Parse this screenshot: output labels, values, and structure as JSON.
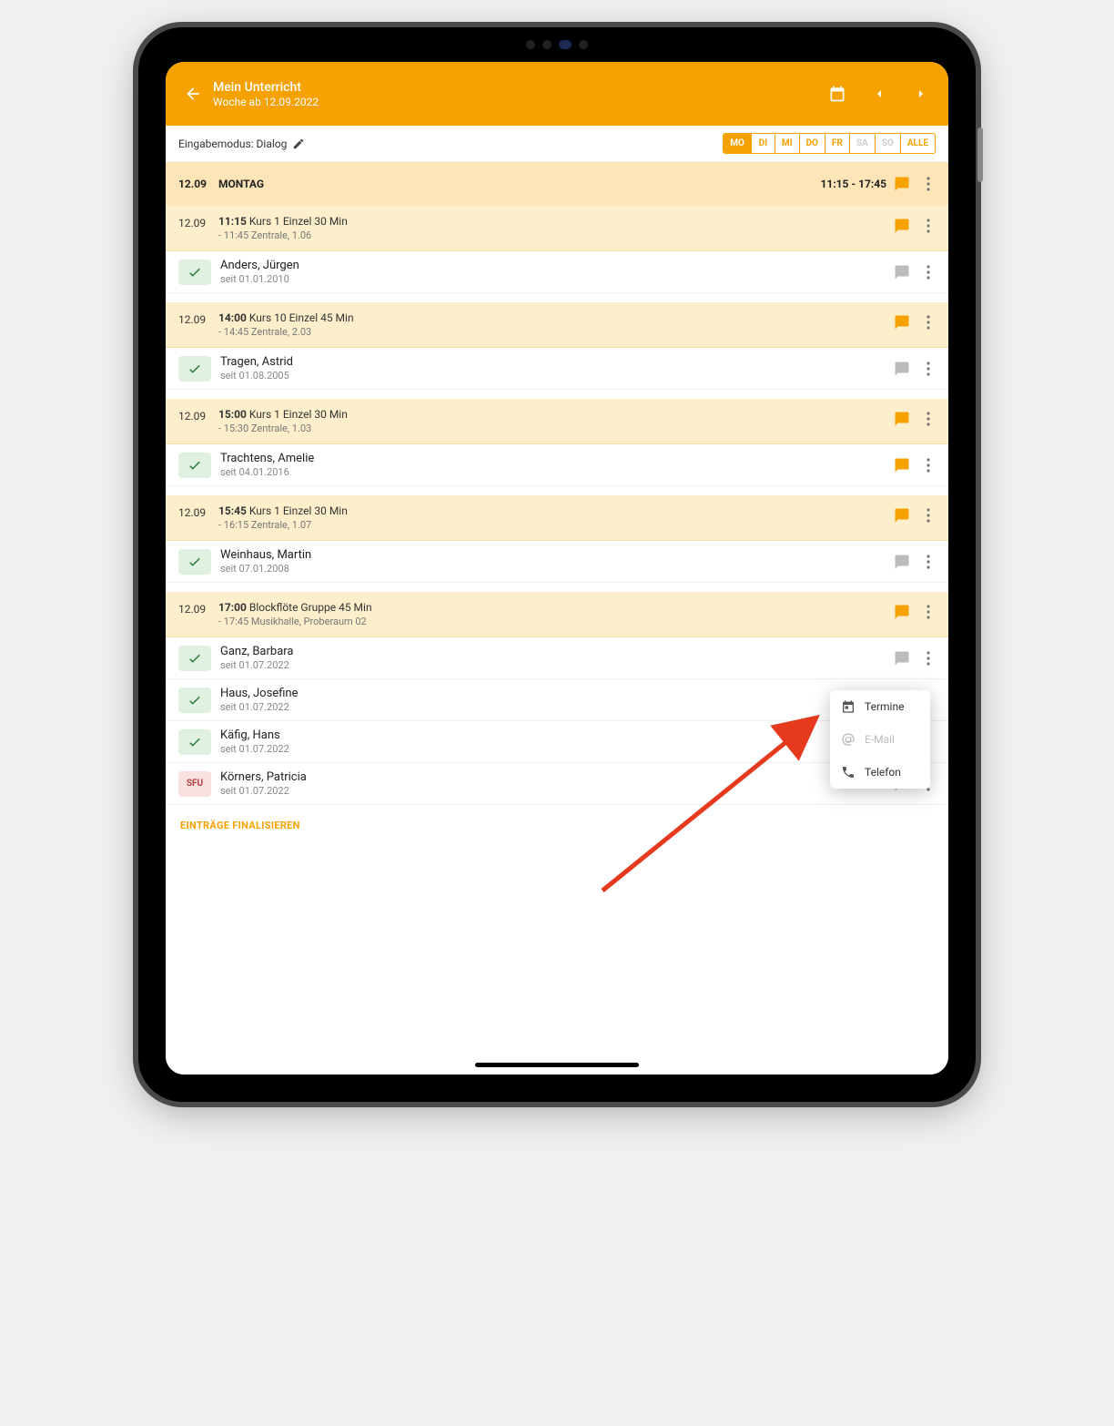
{
  "header": {
    "title": "Mein Unterricht",
    "subtitle": "Woche ab 12.09.2022"
  },
  "modebar": {
    "label": "Eingabemodus: Dialog"
  },
  "daytabs": {
    "mo": "MO",
    "di": "DI",
    "mi": "MI",
    "do": "DO",
    "fr": "FR",
    "sa": "SA",
    "so": "SO",
    "alle": "ALLE"
  },
  "dayHeader": {
    "date": "12.09",
    "name": "MONTAG",
    "time": "11:15 - 17:45"
  },
  "courses": [
    {
      "date": "12.09",
      "timeBold": "11:15",
      "title": "Kurs 1 Einzel 30 Min",
      "sub": "- 11:45 Zentrale, 1.06",
      "students": [
        {
          "chip": "check",
          "name": "Anders, Jürgen",
          "since": "seit 01.01.2010",
          "chat": "gray"
        }
      ]
    },
    {
      "date": "12.09",
      "timeBold": "14:00",
      "title": "Kurs 10 Einzel 45 Min",
      "sub": "- 14:45 Zentrale, 2.03",
      "students": [
        {
          "chip": "check",
          "name": "Tragen, Astrid",
          "since": "seit 01.08.2005",
          "chat": "gray"
        }
      ]
    },
    {
      "date": "12.09",
      "timeBold": "15:00",
      "title": "Kurs 1 Einzel 30 Min",
      "sub": "- 15:30 Zentrale, 1.03",
      "students": [
        {
          "chip": "check",
          "name": "Trachtens, Amelie",
          "since": "seit 04.01.2016",
          "chat": "orange"
        }
      ]
    },
    {
      "date": "12.09",
      "timeBold": "15:45",
      "title": "Kurs 1 Einzel 30 Min",
      "sub": "- 16:15 Zentrale, 1.07",
      "students": [
        {
          "chip": "check",
          "name": "Weinhaus, Martin",
          "since": "seit 07.01.2008",
          "chat": "gray"
        }
      ]
    },
    {
      "date": "12.09",
      "timeBold": "17:00",
      "title": "Blockflöte Gruppe 45 Min",
      "sub": "- 17:45 Musikhalle, Proberaum 02",
      "students": [
        {
          "chip": "check",
          "name": "Ganz, Barbara",
          "since": "seit 01.07.2022",
          "chat": "gray"
        },
        {
          "chip": "check",
          "name": "Haus, Josefine",
          "since": "seit 01.07.2022",
          "chat": "gray"
        },
        {
          "chip": "check",
          "name": "Käfig, Hans",
          "since": "seit 01.07.2022",
          "chat": "gray"
        },
        {
          "chip": "SFU",
          "name": "Körners, Patricia",
          "since": "seit 01.07.2022",
          "chat": "gray"
        }
      ]
    }
  ],
  "finalize": "EINTRÄGE FINALISIEREN",
  "popup": {
    "termine": "Termine",
    "email": "E-Mail",
    "telefon": "Telefon"
  }
}
